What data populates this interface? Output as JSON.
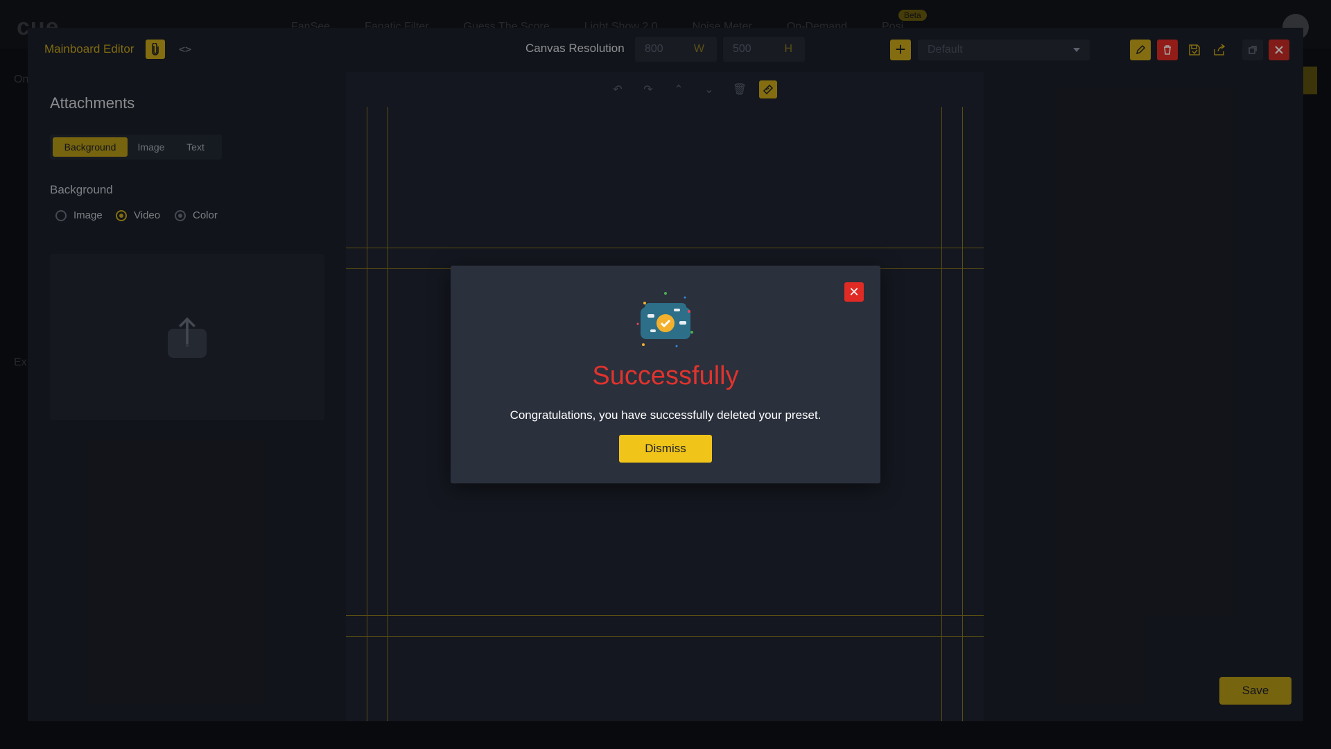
{
  "background_app": {
    "logo": "cue",
    "nav": [
      "FanSee",
      "Fanatic Filter",
      "Guess The Score",
      "Light Show 2.0",
      "Noise Meter",
      "On-Demand",
      "Posi"
    ],
    "beta_badge": "Beta",
    "side_label_1": "On",
    "side_label_2": "Ex"
  },
  "editor": {
    "title": "Mainboard Editor",
    "canvas_resolution_label": "Canvas Resolution",
    "width_value": "800",
    "width_unit": "W",
    "height_value": "500",
    "height_unit": "H",
    "preset_select": "Default",
    "save_label": "Save"
  },
  "attachments": {
    "title": "Attachments",
    "tabs": [
      {
        "label": "Background",
        "active": true
      },
      {
        "label": "Image",
        "active": false
      },
      {
        "label": "Text",
        "active": false
      }
    ],
    "background_label": "Background",
    "radio_options": [
      {
        "label": "Image",
        "state": "unchecked"
      },
      {
        "label": "Video",
        "state": "checked"
      },
      {
        "label": "Color",
        "state": "disabled"
      }
    ]
  },
  "dialog": {
    "title": "Successfully",
    "message": "Congratulations, you have successfully deleted your preset.",
    "dismiss_label": "Dismiss"
  },
  "colors": {
    "accent": "#c9a81a",
    "danger": "#e0332d",
    "panel": "#1b1f28"
  },
  "icons": [
    "clip-icon",
    "code-icon",
    "plus-icon",
    "pencil-icon",
    "trash-icon",
    "save-preset-icon",
    "share-icon",
    "minimize-icon",
    "close-icon",
    "undo-icon",
    "redo-icon",
    "chevron-up-icon",
    "chevron-down-icon",
    "delete-icon",
    "ruler-icon",
    "upload-icon",
    "success-illustration-icon"
  ]
}
